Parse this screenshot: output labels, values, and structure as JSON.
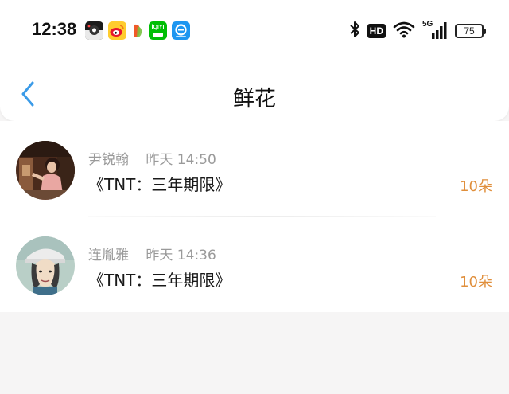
{
  "status_bar": {
    "time": "12:38",
    "app_icons": [
      "camera-app-icon",
      "weibo-icon",
      "jelly-app-icon",
      "iqiyi-icon",
      "browser-app-icon"
    ],
    "iqiyi_text": "iQIYI",
    "network": "5G",
    "hd": "HD",
    "battery": "75"
  },
  "header": {
    "back_icon": "chevron-left-icon",
    "title": "鲜花"
  },
  "rows": [
    {
      "sender": "尹锐翰",
      "time": "昨天 14:50",
      "title": "《TNT：三年期限》",
      "count": "10朵"
    },
    {
      "sender": "连胤雅",
      "time": "昨天 14:36",
      "title": "《TNT：三年期限》",
      "count": "10朵"
    }
  ],
  "colors": {
    "accent_blue": "#3b9be8",
    "count_orange": "#e08f3c",
    "meta_gray": "#9a9a9a",
    "background": "#f6f5f5"
  }
}
